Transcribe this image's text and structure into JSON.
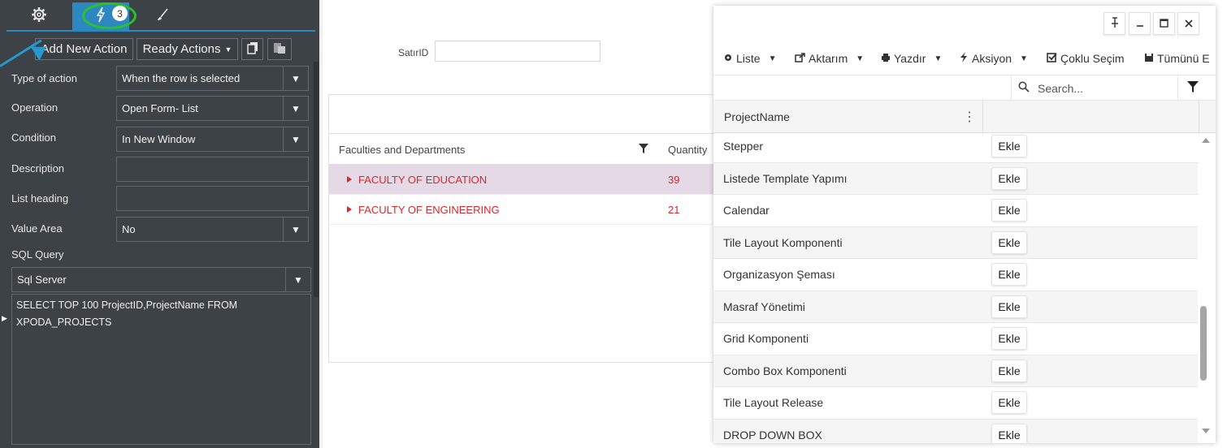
{
  "left_panel": {
    "tabs": [
      {
        "icon": "gear-icon"
      },
      {
        "icon": "bolt-icon",
        "badge": "3"
      },
      {
        "icon": "brush-icon"
      }
    ],
    "buttons": {
      "add_new_action": "Add New Action",
      "ready_actions": "Ready Actions",
      "copy_icon": "copy-icon",
      "paste_icon": "paste-icon"
    },
    "fields": {
      "type_of_action": {
        "label": "Type of action",
        "value": "When the row is selected"
      },
      "operation": {
        "label": "Operation",
        "value": "Open Form- List"
      },
      "condition": {
        "label": "Condition",
        "value": "In New Window"
      },
      "description": {
        "label": "Description",
        "value": ""
      },
      "list_heading": {
        "label": "List heading",
        "value": ""
      },
      "value_area": {
        "label": "Value Area",
        "value": "No"
      },
      "sql_query": {
        "label": "SQL Query",
        "dialect": "Sql Server",
        "text": "SELECT TOP 100 ProjectID,ProjectName FROM XPODA_PROJECTS"
      }
    }
  },
  "middle": {
    "satir_label": "SatırID",
    "grid": {
      "columns": [
        "Faculties and Departments",
        "Quantity"
      ],
      "rows": [
        {
          "name": "FACULTY OF EDUCATION",
          "quantity": "39"
        },
        {
          "name": "FACULTY OF ENGINEERING",
          "quantity": "21"
        }
      ]
    }
  },
  "popup": {
    "window_buttons": [
      "pin-icon",
      "minimize-icon",
      "maximize-icon",
      "close-icon"
    ],
    "toolbar": {
      "liste": "Liste",
      "aktarim": "Aktarım",
      "yazdir": "Yazdır",
      "aksiyon": "Aksiyon",
      "coklu_secim": "Çoklu Seçim",
      "tumunu": "Tümünü E"
    },
    "search_placeholder": "Search...",
    "column_header": "ProjectName",
    "add_label": "Ekle",
    "rows": [
      "Stepper",
      "Listede Template Yapımı",
      "Calendar",
      "Tile Layout Komponenti",
      "Organizasyon Şeması",
      "Masraf Yönetimi",
      "Grid Komponenti",
      "Combo Box Komponenti",
      "Tile Layout Release",
      "DROP DOWN BOX"
    ]
  },
  "colors": {
    "panel_bg": "#3d4247",
    "accent_blue": "#2d87c0",
    "highlight_green": "#29c22b",
    "row_red": "#d9262b",
    "selected_row": "#e6d9e6"
  }
}
